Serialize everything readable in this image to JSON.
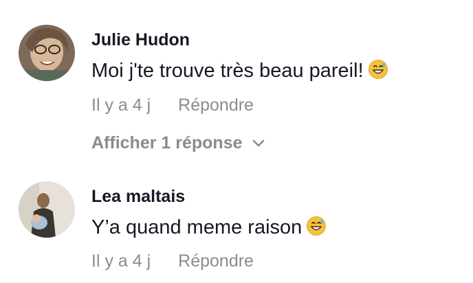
{
  "comments": [
    {
      "author": "Julie Hudon",
      "text": "Moi j'te trouve très beau pareil!",
      "emoji": "grinning-face-with-sweat-icon",
      "time": "Il y a 4 j",
      "reply_label": "Répondre",
      "view_replies_label": "Afficher 1 réponse"
    },
    {
      "author": "Lea maltais",
      "text": "Y’a quand meme raison",
      "emoji": "grinning-face-with-sweat-icon",
      "time": "Il y a 4 j",
      "reply_label": "Répondre"
    }
  ],
  "colors": {
    "text": "#161823",
    "secondary": "#8a8b91",
    "background": "#ffffff"
  }
}
